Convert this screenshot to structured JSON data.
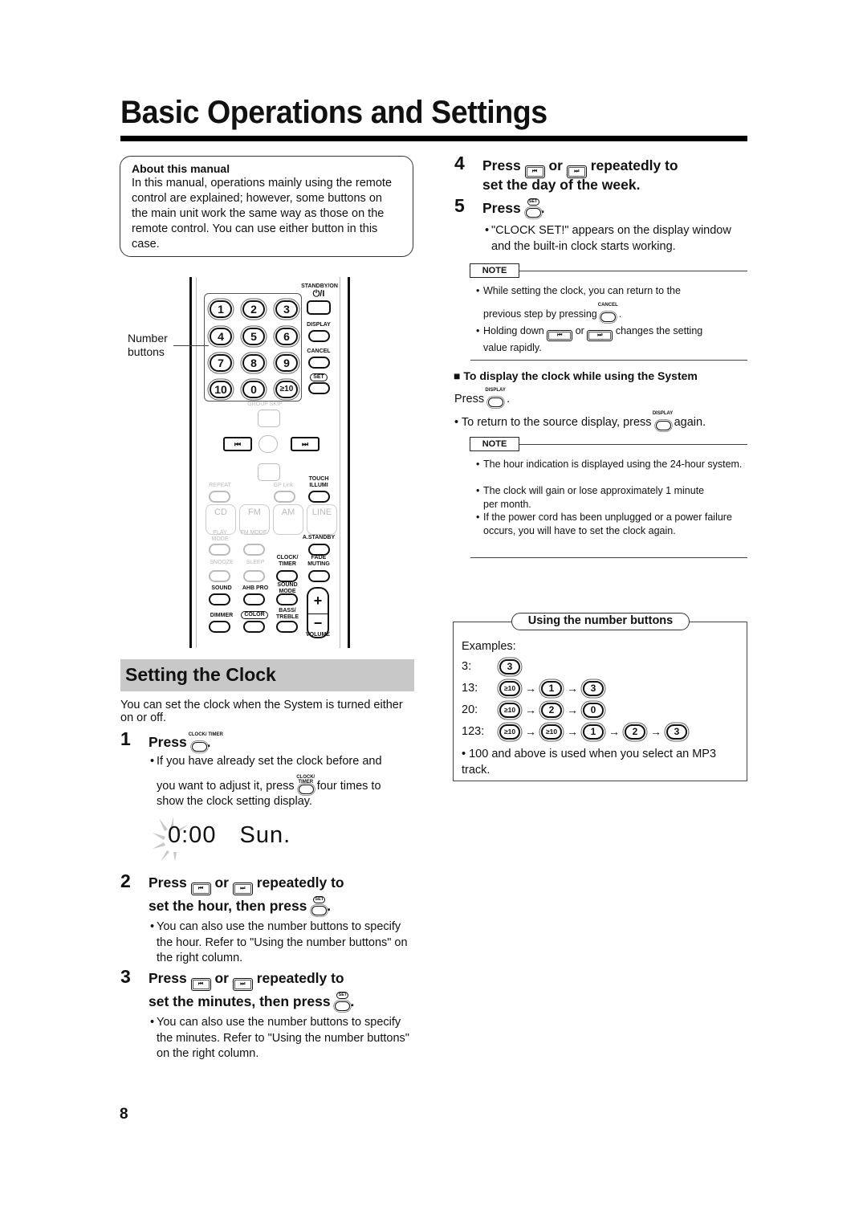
{
  "page": {
    "title": "Basic Operations and Settings",
    "page_number": "8"
  },
  "about": {
    "title": "About this manual",
    "body": "In this manual, operations mainly using the remote control are explained; however, some buttons on the main unit work the same way as those on the remote control. You can use either button in this case."
  },
  "remote": {
    "callout_label": "Number buttons",
    "number_buttons": [
      "1",
      "2",
      "3",
      "4",
      "5",
      "6",
      "7",
      "8",
      "9",
      "10",
      "0",
      "≥10"
    ],
    "side_labels": {
      "standby": "STANDBY/ON",
      "power_glyph": "⏻/I",
      "display": "DISPLAY",
      "cancel": "CANCEL",
      "set": "SET"
    },
    "group_skip": "GROUP SKIP",
    "skip_prev_glyph": "⏮",
    "skip_next_glyph": "⏭",
    "labels": {
      "repeat": "REPEAT",
      "gp_link": "GP Link",
      "touch_illumi": "TOUCH ILLUMI",
      "cd": "CD",
      "fm": "FM",
      "am": "AM",
      "line": "LINE",
      "play_mode": "PLAY MODE",
      "fm_mode": "FM MODE",
      "a_standby": "A.STANDBY",
      "snooze": "SNOOZE",
      "sleep": "SLEEP",
      "clock_timer": "CLOCK/ TIMER",
      "fade_muting": "FADE MUTING",
      "cc_sound": "SOUND",
      "ahb_pro": "AHB PRO",
      "sound_mode": "SOUND MODE",
      "dimmer": "DIMMER",
      "color": "COLOR",
      "bass_treble": "BASS/ TREBLE",
      "volume": "VOLUME",
      "plus": "+",
      "minus": "−"
    }
  },
  "clock_section": {
    "header": "Setting the Clock",
    "intro": "You can set the clock when the System is turned either on or off.",
    "steps": [
      {
        "num": "1",
        "title_a": "Press",
        "bullet_a": "If you have already set the clock before and",
        "bullet_b": "you want to adjust it, press",
        "bullet_c": "four times to",
        "bullet_d": "show the clock setting display."
      },
      {
        "num": "2",
        "title_a": "Press",
        "title_or": "or",
        "title_b": "repeatedly to",
        "title_c": "set the hour, then press",
        "bullet": "You can also use the number buttons to specify the hour. Refer to \"Using the number buttons\" on the right column."
      },
      {
        "num": "3",
        "title_a": "Press",
        "title_or": "or",
        "title_b": "repeatedly to",
        "title_c": "set the minutes, then press",
        "bullet": "You can also use the number buttons to specify the minutes. Refer to \"Using the number buttons\" on the right column."
      }
    ],
    "display": {
      "time": "0:00",
      "day": "Sun."
    }
  },
  "right_column": {
    "step4": {
      "num": "4",
      "title_a": "Press",
      "title_or": "or",
      "title_b": "repeatedly to",
      "title_c": "set the day of the week."
    },
    "step5": {
      "num": "5",
      "title": "Press",
      "bullet": "\"CLOCK SET!\" appears on the display window and the built-in clock starts working."
    },
    "note1": {
      "tag": "NOTE",
      "items": [
        {
          "a": "While setting the clock, you can return to the",
          "b": "previous step by pressing"
        },
        {
          "a": "Holding down",
          "or": "or",
          "b": "changes the setting",
          "c": "value rapidly."
        }
      ]
    },
    "display_clock": {
      "heading": "To display the clock while using the System",
      "press": "Press",
      "bullet_a": "To return to the source display, press",
      "bullet_b": "again."
    },
    "note2": {
      "tag": "NOTE",
      "items": [
        "The hour indication is displayed using the 24-hour system.",
        "The clock will gain or lose approximately 1 minute per month.",
        "If the power cord has been unplugged or a power failure occurs, you will have to set the clock again."
      ]
    },
    "number_box": {
      "title": "Using the number buttons",
      "examples_label": "Examples:",
      "examples": [
        {
          "label": "3:",
          "buttons": [
            "3"
          ]
        },
        {
          "label": "13:",
          "buttons": [
            "≥10",
            "1",
            "3"
          ]
        },
        {
          "label": "20:",
          "buttons": [
            "≥10",
            "2",
            "0"
          ]
        },
        {
          "label": "123:",
          "buttons": [
            "≥10",
            "≥10",
            "1",
            "2",
            "3"
          ]
        }
      ],
      "arrow": "→",
      "bullet": "100 and above is used when you select an MP3 track."
    }
  },
  "icons": {
    "skip_prev": "⏮",
    "skip_next": "⏭",
    "bullet": "•",
    "square_bullet": "■",
    "set_cap": "SET",
    "display_cap": "DISPLAY",
    "cancel_cap": "CANCEL",
    "clock_cap": "CLOCK/ TIMER"
  }
}
